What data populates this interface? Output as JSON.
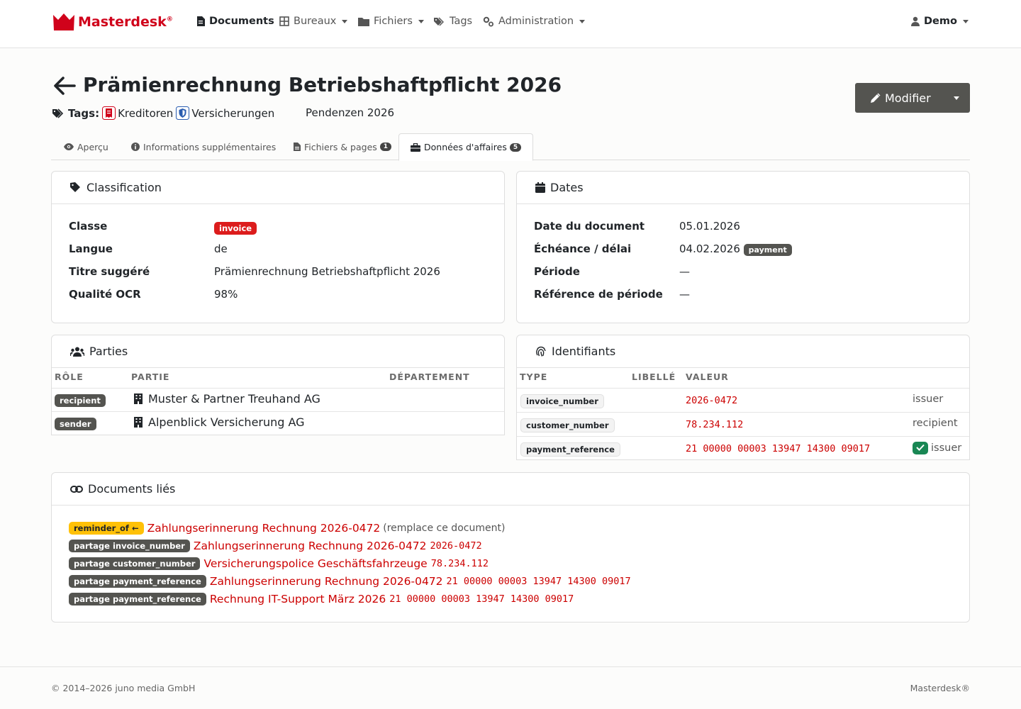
{
  "brand": {
    "name": "Masterdesk",
    "mark": "®"
  },
  "nav": {
    "documents": "Documents",
    "bureaux": "Bureaux",
    "fichiers": "Fichiers",
    "tags": "Tags",
    "administration": "Administration",
    "user": "Demo"
  },
  "header": {
    "title": "Prämienrechnung Betriebshaftpflicht 2026",
    "tags_label": "Tags:",
    "tags": [
      "Kreditoren",
      "Versicherungen"
    ],
    "pending": "Pendenzen 2026",
    "edit_label": "Modifier"
  },
  "tabs": [
    {
      "label": "Aperçu"
    },
    {
      "label": "Informations supplémentaires"
    },
    {
      "label": "Fichiers & pages",
      "count": "1"
    },
    {
      "label": "Données d'affaires",
      "count": "5"
    }
  ],
  "classification": {
    "title": "Classification",
    "rows": [
      {
        "key": "Classe",
        "value": "invoice"
      },
      {
        "key": "Langue",
        "value": "de"
      },
      {
        "key": "Titre suggéré",
        "value": "Prämienrechnung Betriebshaftpflicht 2026"
      },
      {
        "key": "Qualité OCR",
        "value": "98%"
      }
    ]
  },
  "dates": {
    "title": "Dates",
    "rows": [
      {
        "key": "Date du document",
        "value": "05.01.2026"
      },
      {
        "key": "Échéance / délai",
        "value": "04.02.2026",
        "badge": "payment"
      },
      {
        "key": "Période",
        "value": "—"
      },
      {
        "key": "Référence de période",
        "value": "—"
      }
    ]
  },
  "parties": {
    "title": "Parties",
    "headers": [
      "RÔLE",
      "PARTIE",
      "DÉPARTEMENT"
    ],
    "rows": [
      {
        "role": "recipient",
        "party": "Muster & Partner Treuhand AG"
      },
      {
        "role": "sender",
        "party": "Alpenblick Versicherung AG"
      }
    ]
  },
  "identifiants": {
    "title": "Identifiants",
    "headers": [
      "TYPE",
      "LIBELLÉ",
      "VALEUR"
    ],
    "rows": [
      {
        "type": "invoice_number",
        "value": "2026-0472",
        "side": "issuer"
      },
      {
        "type": "customer_number",
        "value": "78.234.112",
        "side": "recipient"
      },
      {
        "type": "payment_reference",
        "value": "21 00000 00003 13947 14300 09017",
        "side": "issuer",
        "verified": true
      }
    ]
  },
  "linked": {
    "title": "Documents liés",
    "rows": [
      {
        "badge": "reminder_of ←",
        "title": "Zahlungserinnerung Rechnung 2026-0472",
        "note": "(remplace ce document)"
      },
      {
        "badge": "partage invoice_number",
        "title": "Zahlungserinnerung Rechnung 2026-0472",
        "ref": "2026-0472"
      },
      {
        "badge": "partage customer_number",
        "title": "Versicherungspolice Geschäftsfahrzeuge",
        "ref": "78.234.112"
      },
      {
        "badge": "partage payment_reference",
        "title": "Zahlungserinnerung Rechnung 2026-0472",
        "ref": "21 00000 00003 13947 14300 09017"
      },
      {
        "badge": "partage payment_reference",
        "title": "Rechnung IT-Support März 2026",
        "ref": "21 00000 00003 13947 14300 09017"
      }
    ]
  },
  "footer": {
    "copyright": "© 2014–2026 juno media GmbH",
    "product": "Masterdesk®"
  }
}
